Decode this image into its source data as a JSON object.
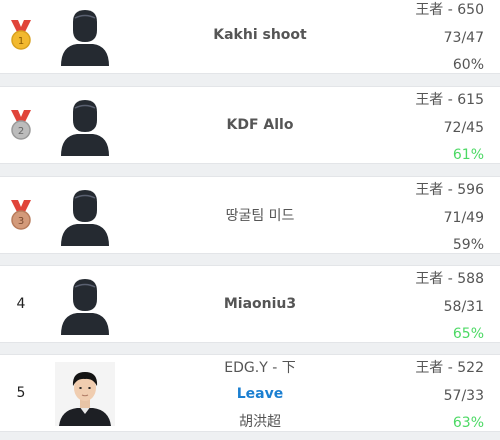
{
  "colors": {
    "win_rate_green": "#4cd964",
    "leave_blue": "#1b7fd1",
    "medal_red": "#e0443a",
    "gold": "#f2b92f",
    "silver": "#bcbcbc",
    "bronze": "#d39a7a",
    "avatar_dark": "#252a31"
  },
  "players": [
    {
      "rank": "1",
      "medal": "gold",
      "name": "Kakhi shoot",
      "tier": "王者 - 650",
      "record": "73/47",
      "win_rate": "60%",
      "win_rate_highlight": false
    },
    {
      "rank": "2",
      "medal": "silver",
      "name": "KDF Allo",
      "tier": "王者 - 615",
      "record": "72/45",
      "win_rate": "61%",
      "win_rate_highlight": true
    },
    {
      "rank": "3",
      "medal": "bronze",
      "name": "땅굴팀 미드",
      "tier": "王者 - 596",
      "record": "71/49",
      "win_rate": "59%",
      "win_rate_highlight": false
    },
    {
      "rank": "4",
      "medal": null,
      "name": "Miaoniu3",
      "tier": "王者 - 588",
      "record": "58/31",
      "win_rate": "65%",
      "win_rate_highlight": true
    },
    {
      "rank": "5",
      "medal": null,
      "team_line": "EDG.Y - 下",
      "status": "Leave",
      "real_name": "胡洪超",
      "tier": "王者 - 522",
      "record": "57/33",
      "win_rate": "63%",
      "win_rate_highlight": true
    }
  ]
}
